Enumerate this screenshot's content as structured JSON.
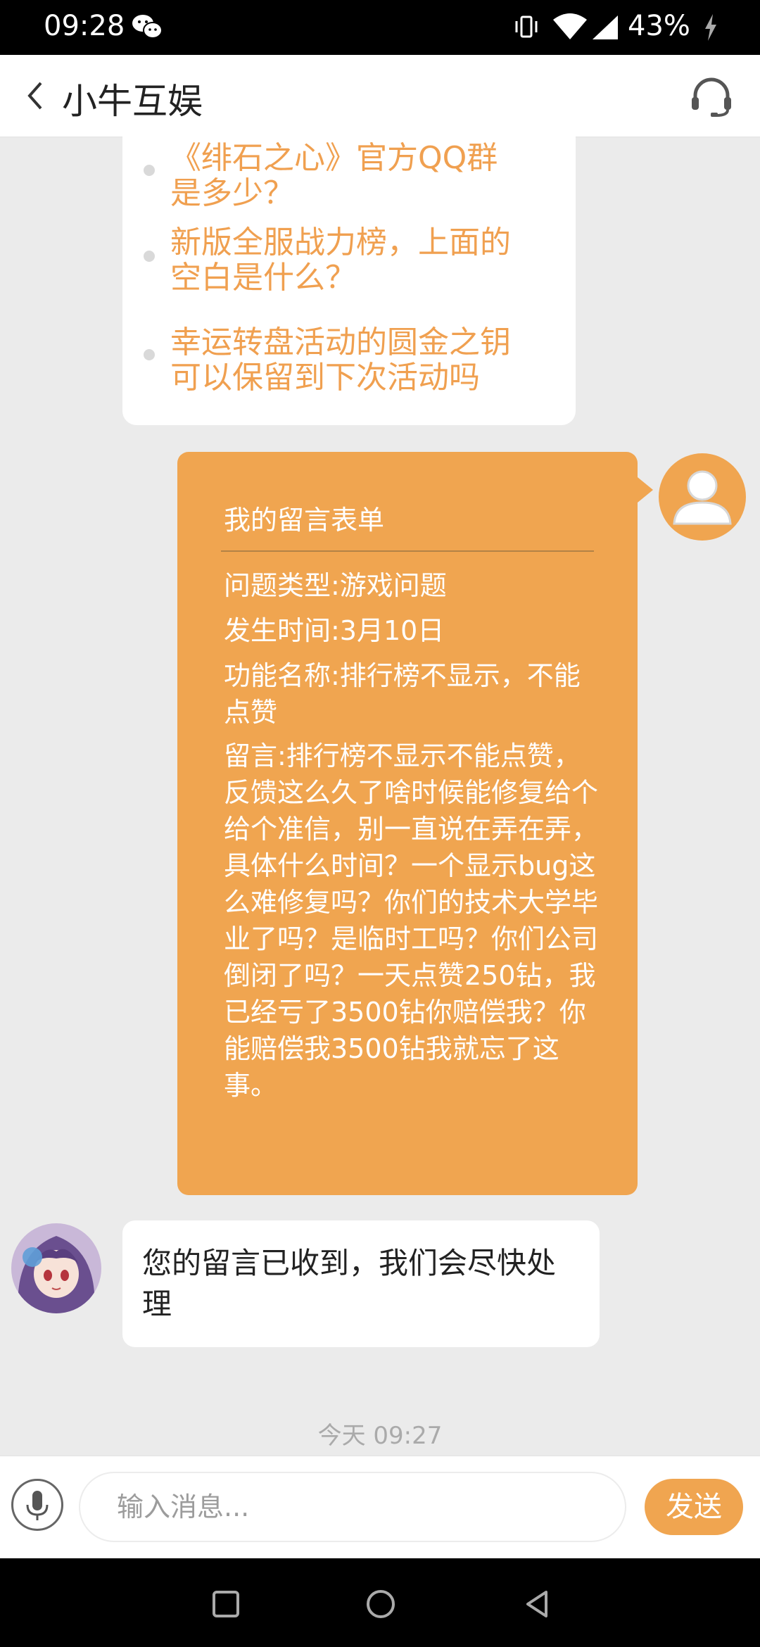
{
  "status_bar": {
    "time": "09:28",
    "battery": "43%",
    "icons": [
      "wechat-icon",
      "vibrate-icon",
      "wifi-icon",
      "cellular-signal-icon",
      "charging-bolt-icon"
    ]
  },
  "header": {
    "title": "小牛互娱",
    "back_icon": "chevron-left-icon",
    "support_icon": "headset-icon"
  },
  "faq": {
    "items": [
      {
        "line1": "《绯石之心》官方QQ群",
        "line2": "是多少？"
      },
      {
        "line1": "新版全服战力榜，上面的",
        "line2": "空白是什么？"
      },
      {
        "line1": "幸运转盘活动的圆金之钥",
        "line2": "可以保留到下次活动吗"
      }
    ]
  },
  "form_message": {
    "title": "我的留言表单",
    "fields": [
      "问题类型:游戏问题",
      "发生时间:3月10日",
      "功能名称:排行榜不显示，不能点赞",
      "留言:排行榜不显示不能点赞，反馈这么久了啥时候能修复给个给个准信，别一直说在弄在弄，具体什么时间？一个显示bug这么难修复吗？你们的技术大学毕业了吗？是临时工吗？你们公司倒闭了吗？一天点赞250钻，我已经亏了3500钻你赔偿我？你能赔偿我3500钻我就忘了这事。"
    ]
  },
  "reply": {
    "text": "您的留言已收到，我们会尽快处理"
  },
  "timestamp": "今天 09:27",
  "input_bar": {
    "placeholder": "输入消息...",
    "send_label": "发送"
  },
  "colors": {
    "accent": "#f0a550",
    "faq_text": "#f0a050",
    "background": "#ebebeb"
  }
}
